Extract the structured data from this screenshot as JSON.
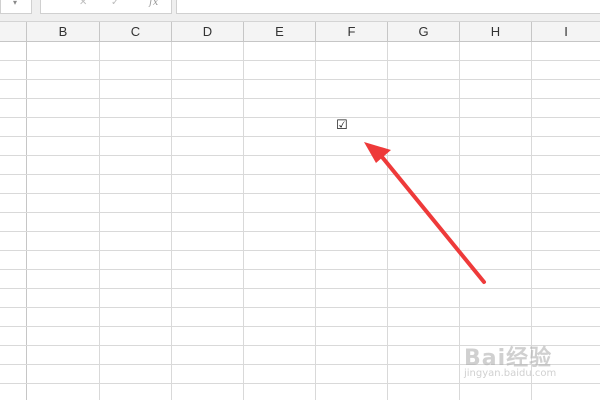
{
  "formula_bar": {
    "name_box_dropdown": "▾",
    "cancel_glyph": "✕",
    "enter_glyph": "✓",
    "fx_label": "fx",
    "formula_value": ""
  },
  "columns": [
    "B",
    "C",
    "D",
    "E",
    "F",
    "G",
    "H",
    "I"
  ],
  "cell_F5": {
    "content": "☑"
  },
  "annotation": {
    "type": "arrow",
    "color": "#ee3a3a",
    "points_to": "F5"
  },
  "watermark": {
    "text": "Bai经验",
    "sub": "jingyan.baidu.com"
  }
}
